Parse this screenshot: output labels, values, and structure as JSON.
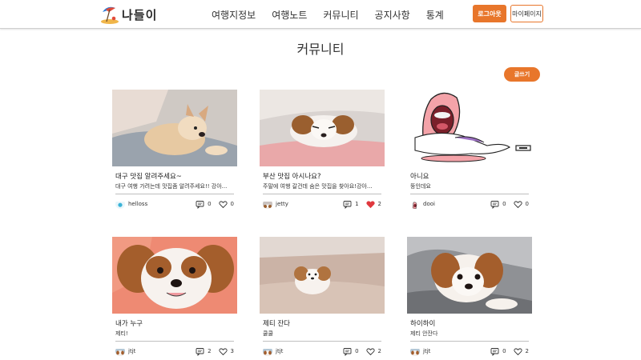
{
  "header": {
    "logo_text": "나들이",
    "nav": [
      "여행지정보",
      "여행노트",
      "커뮤니티",
      "공지사항",
      "통계"
    ],
    "logout_label": "로그아웃",
    "mypage_label": "마이페이지"
  },
  "page": {
    "title": "커뮤니티",
    "write_label": "글쓰기"
  },
  "colors": {
    "accent": "#e8762b",
    "liked": "#e0393e"
  },
  "posts": [
    {
      "title": "대구 맛집 알려주세요~",
      "excerpt": "대구 여행 가려는데 맛집좀 알려주세요!! 강아...",
      "author": "helloss",
      "comments": "0",
      "likes": "0",
      "liked": false
    },
    {
      "title": "부산 맛집 아시나요?",
      "excerpt": "주말에 여행 갈건데 숨은 맛집을 찾아요!강아...",
      "author": "jetty",
      "comments": "1",
      "likes": "2",
      "liked": true
    },
    {
      "title": "아니요",
      "excerpt": "뚱인데요",
      "author": "dooi",
      "comments": "0",
      "likes": "0",
      "liked": false
    },
    {
      "title": "내가 누구",
      "excerpt": "제티!",
      "author": "jtjt",
      "comments": "2",
      "likes": "3",
      "liked": false
    },
    {
      "title": "제티 잔다",
      "excerpt": "쿨쿨",
      "author": "jtjt",
      "comments": "0",
      "likes": "2",
      "liked": false
    },
    {
      "title": "하이하이",
      "excerpt": "제티 안잔다",
      "author": "jtjt",
      "comments": "0",
      "likes": "2",
      "liked": false
    }
  ]
}
